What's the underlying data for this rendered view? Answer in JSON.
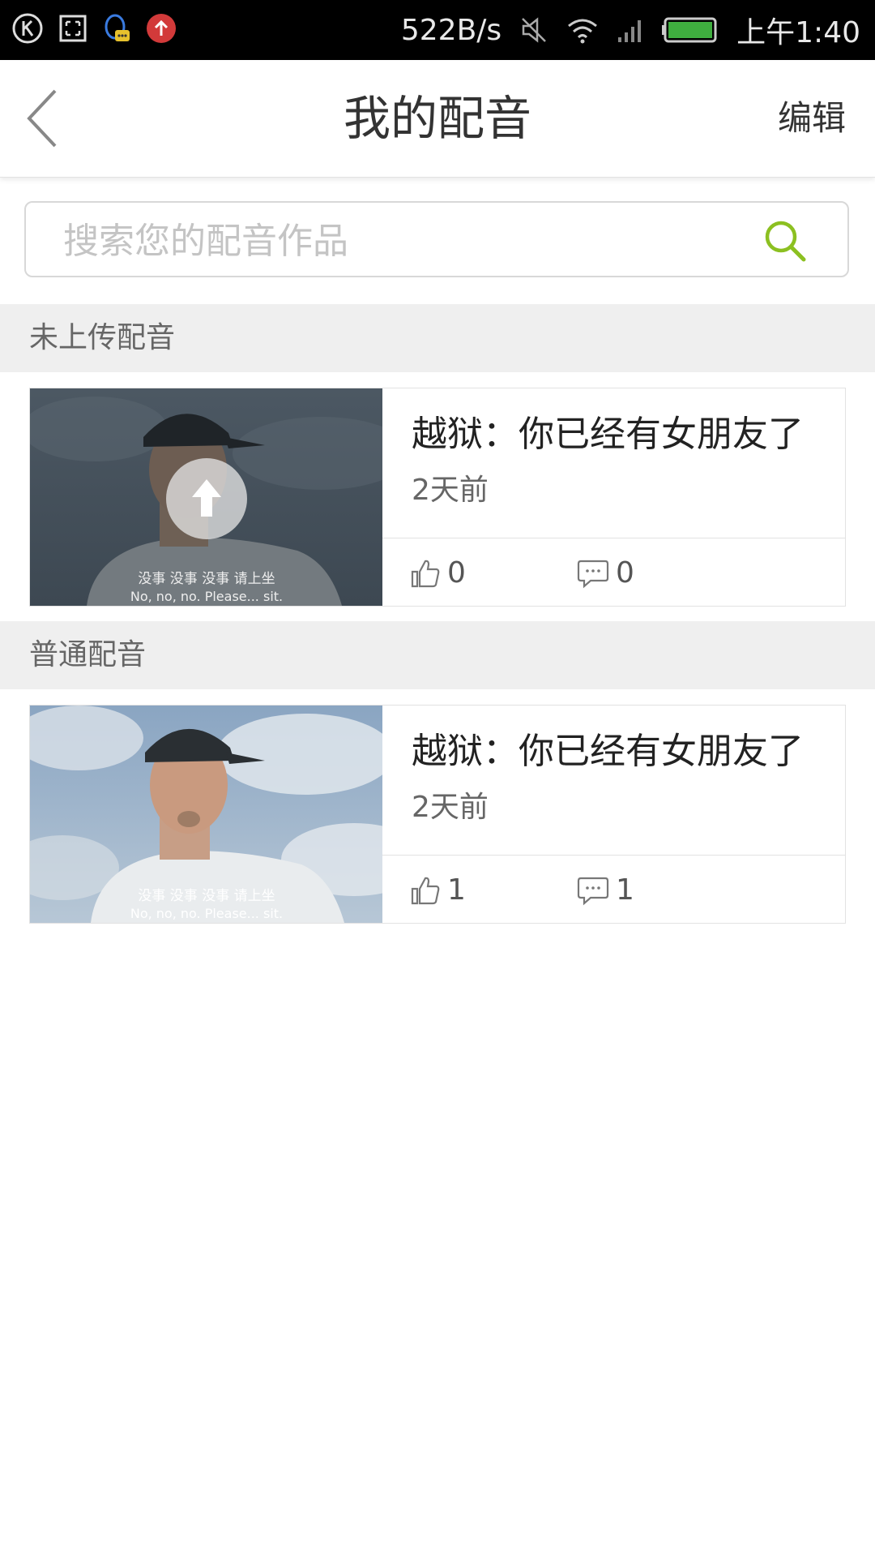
{
  "status_bar": {
    "net_speed": "522B/s",
    "time": "上午1:40",
    "icons": [
      "k-icon",
      "screenshot-icon",
      "qq-icon",
      "upload-notify-icon",
      "mute-icon",
      "wifi-icon",
      "signal-icon",
      "battery-icon"
    ]
  },
  "header": {
    "title": "我的配音",
    "edit_label": "编辑"
  },
  "search": {
    "placeholder": "搜索您的配音作品",
    "value": ""
  },
  "sections": [
    {
      "title": "未上传配音",
      "items": [
        {
          "title": "越狱：你已经有女朋友了",
          "time": "2天前",
          "likes": "0",
          "comments": "0",
          "subtitle_zh": "没事 没事 没事 请上坐",
          "subtitle_en": "No, no, no. Please... sit."
        }
      ]
    },
    {
      "title": "普通配音",
      "items": [
        {
          "title": "越狱：你已经有女朋友了",
          "time": "2天前",
          "likes": "1",
          "comments": "1",
          "subtitle_zh": "没事 没事 没事 请上坐",
          "subtitle_en": "No, no, no. Please... sit."
        }
      ]
    }
  ],
  "colors": {
    "accent": "#8cc021",
    "section_bg": "#efefef",
    "status_bar_bg": "#000000",
    "notify_red": "#d23a3a"
  }
}
